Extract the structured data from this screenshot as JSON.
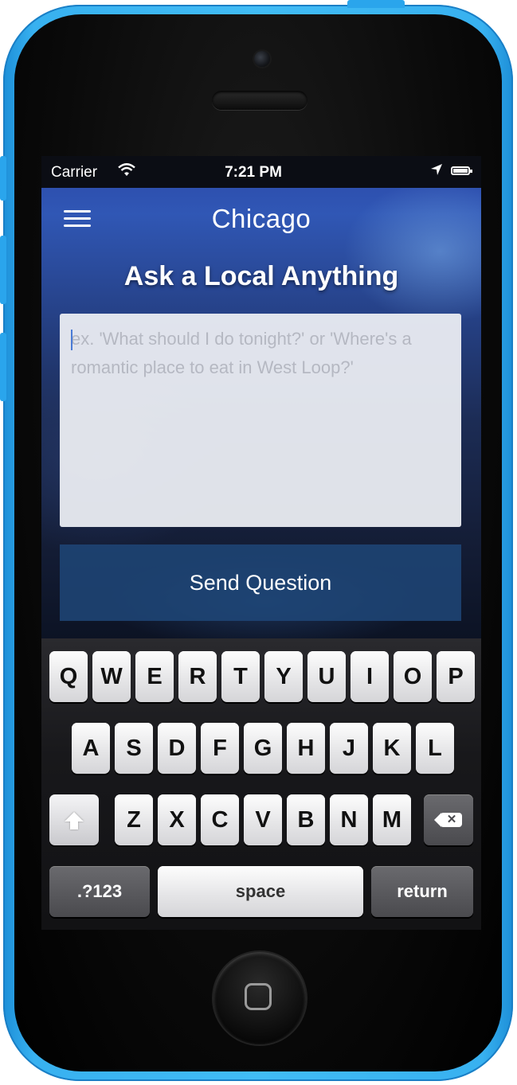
{
  "status_bar": {
    "carrier": "Carrier",
    "time": "7:21 PM",
    "wifi_icon": "wifi-icon",
    "location_icon": "location-arrow-icon",
    "battery_icon": "battery-icon"
  },
  "nav": {
    "menu_icon": "hamburger-menu-icon",
    "title": "Chicago"
  },
  "main": {
    "headline": "Ask a Local Anything",
    "question_placeholder": "ex. 'What should I do tonight?' or 'Where's a romantic place to eat in West Loop?'",
    "send_label": "Send Question"
  },
  "keyboard": {
    "row1": [
      "Q",
      "W",
      "E",
      "R",
      "T",
      "Y",
      "U",
      "I",
      "O",
      "P"
    ],
    "row2": [
      "A",
      "S",
      "D",
      "F",
      "G",
      "H",
      "J",
      "K",
      "L"
    ],
    "row3": [
      "Z",
      "X",
      "C",
      "V",
      "B",
      "N",
      "M"
    ],
    "shift_icon": "shift-arrow-icon",
    "backspace_icon": "backspace-icon",
    "numbers_label": ".?123",
    "space_label": "space",
    "return_label": "return"
  },
  "colors": {
    "phone_shell": "#41bcf5",
    "send_button": "#1e4678",
    "nav_gradient_top": "#2b48a8"
  }
}
